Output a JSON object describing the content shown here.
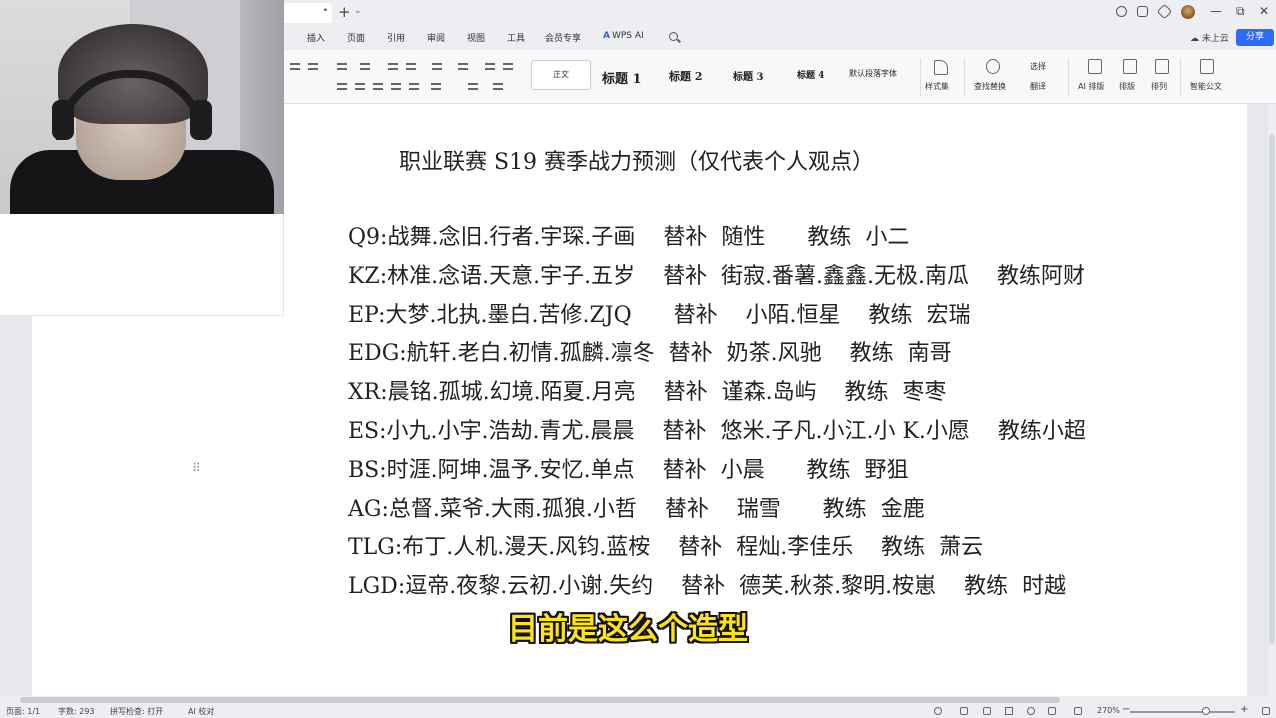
{
  "titlebar": {
    "tab_close": "•",
    "new_tab": "+",
    "tab_caret": "⌄",
    "window_controls": {
      "minimize": "—",
      "restore": "⧉",
      "close": "✕"
    }
  },
  "menu": {
    "items": [
      "插入",
      "页面",
      "引用",
      "审阅",
      "视图",
      "工具",
      "会员专享"
    ],
    "wps_ai_label": "WPS AI",
    "cloud_label": "未上云",
    "share_label": "分享"
  },
  "ribbon": {
    "style_box_label": "正文",
    "styles": [
      "标题 1",
      "标题 2",
      "标题 3",
      "标题 4"
    ],
    "default_paragraph_font": "默认段落字体",
    "style_set": "样式集",
    "find_replace": "查找替换",
    "select": "选择",
    "translate": "翻译",
    "ai_layout": "AI 排版",
    "layout": "排版",
    "arrange": "排列",
    "smart_doc": "智能公文"
  },
  "document": {
    "title": "职业联赛 S19 赛季战力预测（仅代表个人观点）",
    "rosters": [
      "Q9:战舞.念旧.行者.宇琛.子画    替补  随性      教练  小二",
      "KZ:林准.念语.天意.宇子.五岁    替补  街寂.番薯.鑫鑫.无极.南瓜    教练阿财",
      "EP:大梦.北执.墨白.苦修.ZJQ      替补    小陌.恒星    教练  宏瑞",
      "EDG:航轩.老白.初情.孤麟.凛冬  替补  奶茶.风驰    教练  南哥",
      "XR:晨铭.孤城.幻境.陌夏.月亮    替补  谨森.岛屿    教练  枣枣",
      "ES:小九.小宇.浩劫.青尤.晨晨    替补  悠米.子凡.小江.小 K.小愿    教练小超",
      "BS:时涯.阿坤.温予.安忆.单点    替补  小晨      教练  野狙",
      "AG:总督.菜爷.大雨.孤狼.小哲    替补    瑞雪      教练  金鹿",
      "TLG:布丁.人机.漫天.风钧.蓝桉    替补  程灿.李佳乐    教练  萧云",
      "LGD:逗帝.夜黎.云初.小谢.失约    替补  德芙.秋茶.黎明.桉崽    教练  时越"
    ],
    "text_cursor": "I",
    "move_handle": "⠿"
  },
  "statusbar": {
    "page": "页面: 1/1",
    "word_count": "字数: 293",
    "spell_check": "拼写检查: 打开",
    "ai_proofread": "AI 校对",
    "zoom": "270%",
    "zoom_out": "−",
    "zoom_in": "+"
  },
  "subtitle": "目前是这么个造型",
  "colors": {
    "accent": "#2f6cf6",
    "subtitle": "#ffe21a",
    "wps_ai": "#3b56e6"
  }
}
